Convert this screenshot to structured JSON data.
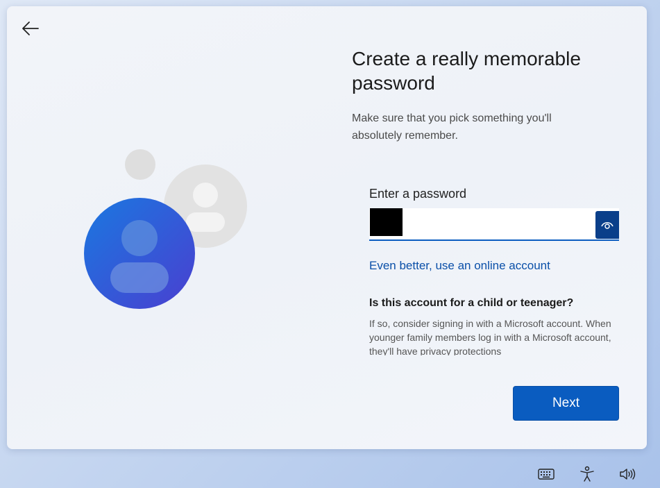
{
  "page": {
    "title": "Create a really memorable password",
    "subtitle": "Make sure that you pick something you'll absolutely remember."
  },
  "password": {
    "label": "Enter a password",
    "value_masked": true
  },
  "links": {
    "online_account": "Even better, use an online account"
  },
  "child_section": {
    "heading": "Is this account for a child or teenager?",
    "body": "If so, consider signing in with a Microsoft account. When younger family members log in with a Microsoft account, they'll have privacy protections"
  },
  "buttons": {
    "next": "Next"
  },
  "icons": {
    "back": "back-arrow-icon",
    "reveal": "eye-icon",
    "keyboard": "keyboard-icon",
    "accessibility": "accessibility-icon",
    "volume": "volume-icon"
  },
  "colors": {
    "accent": "#0a5cc0",
    "link": "#0a4fa8",
    "avatar_blue": "#1e6fd6",
    "avatar_gray": "#dedede"
  }
}
